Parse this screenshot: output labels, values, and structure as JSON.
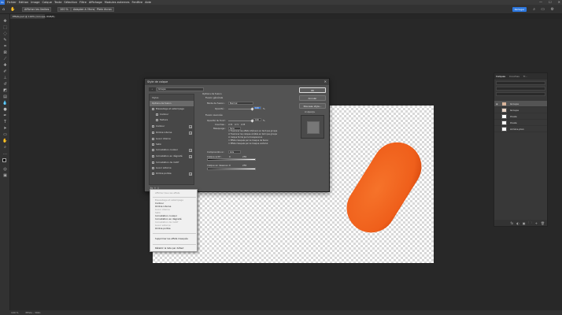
{
  "menubar": {
    "logo": "Ps",
    "items": [
      "Fichier",
      "Edition",
      "Image",
      "Calque",
      "Texte",
      "Sélection",
      "Filtre",
      "Affichage",
      "Modules externes",
      "Fenêtre",
      "Aide"
    ],
    "window_controls": [
      "—",
      "☐",
      "✕"
    ]
  },
  "optionsbar": {
    "chips": [
      "Afficher les limites",
      "100 %",
      "Adapter à l'écran",
      "Plein écran"
    ],
    "share_label": "Partager"
  },
  "document": {
    "tab_title": "Effets.psd @ 100% (Groupe, RVB/8)"
  },
  "statusbar": {
    "zoom": "100 %",
    "info": "Effets - 36Ko"
  },
  "layers_panel": {
    "tabs": [
      "Calques",
      "Couches",
      "Tr..."
    ],
    "layers": [
      {
        "name": "Groupe",
        "selected": true
      },
      {
        "name": "Groupe",
        "selected": false
      },
      {
        "name": "Ovale",
        "selected": false
      },
      {
        "name": "Ovale",
        "selected": false
      },
      {
        "name": "Arrière-plan",
        "selected": false
      }
    ],
    "footer_icons": [
      "fx",
      "◐",
      "▣",
      "🗀",
      "+",
      "🗑"
    ]
  },
  "dialog": {
    "title": "Style de calque",
    "close": "✕",
    "search_value": "Groupe",
    "styles_header": "Styles",
    "effects": [
      {
        "label": "Options de fusion",
        "selected": true,
        "checkbox": false,
        "plus": false
      },
      {
        "label": "Biseautage et estampage",
        "selected": false,
        "checkbox": true,
        "plus": false
      },
      {
        "label": "Contour",
        "selected": false,
        "checkbox": true,
        "plus": false,
        "indent": true
      },
      {
        "label": "Texture",
        "selected": false,
        "checkbox": true,
        "plus": false,
        "indent": true
      },
      {
        "label": "Contour",
        "selected": false,
        "checkbox": true,
        "plus": true
      },
      {
        "label": "Ombre interne",
        "selected": false,
        "checkbox": true,
        "plus": true
      },
      {
        "label": "Lueur interne",
        "selected": false,
        "checkbox": true,
        "plus": false
      },
      {
        "label": "Satin",
        "selected": false,
        "checkbox": true,
        "plus": false
      },
      {
        "label": "Incrustation couleur",
        "selected": false,
        "checkbox": true,
        "plus": true
      },
      {
        "label": "Incrustation en dégradé",
        "selected": false,
        "checkbox": true,
        "plus": true
      },
      {
        "label": "Incrustation de motif",
        "selected": false,
        "checkbox": true,
        "plus": false
      },
      {
        "label": "Lueur externe",
        "selected": false,
        "checkbox": true,
        "plus": false
      },
      {
        "label": "Ombre portée",
        "selected": false,
        "checkbox": true,
        "plus": true
      }
    ],
    "right": {
      "section1": "Options de fusion",
      "section1_sub": "Fusion générale",
      "mode_label": "Mode de fusion :",
      "mode_value": "Normal",
      "opacity_label": "Opacité :",
      "opacity_value": "100",
      "opacity_level": 1.0,
      "pct": "%",
      "section2": "Fusion avancée",
      "fill_label": "Opacité du fond :",
      "fill_value": "100",
      "fill_level": 1.0,
      "channels_label": "Couches :",
      "channels": [
        "R",
        "V",
        "B"
      ],
      "knockout_label": "Masquage :",
      "knockout_value": "Sans",
      "options": [
        {
          "label": "Fusionner les effets intérieurs en tant que groupe",
          "checked": false
        },
        {
          "label": "Fusionner les calques écrêtés en tant que groupe",
          "checked": true
        },
        {
          "label": "Calque formé par la transparence",
          "checked": true
        },
        {
          "label": "Effets masqués par le masque de fusion",
          "checked": false
        },
        {
          "label": "Effets masqués par le masque vectoriel",
          "checked": false
        }
      ],
      "blendif_label": "Comprendre si :",
      "blendif_value": "Gris",
      "this_layer_label": "Calque actif :",
      "this_layer_min": "0",
      "this_layer_max": "255",
      "under_layer_label": "Calque en dessous :",
      "under_layer_min": "0",
      "under_layer_max": "255"
    },
    "buttons": {
      "ok": "OK",
      "cancel": "Annuler",
      "new_style": "Nouveau style...",
      "preview": "Aperçu"
    },
    "bottom_icons": "fx ⇧ ⇩"
  },
  "context_menu": {
    "items": [
      {
        "label": "Afficher tous les effets",
        "disabled": true
      },
      {
        "label": "Biseautage et estampage",
        "disabled": true
      },
      {
        "label": "Contour",
        "disabled": false
      },
      {
        "label": "Ombre interne",
        "disabled": false
      },
      {
        "label": "Lueur interne",
        "disabled": true
      },
      {
        "label": "Satin",
        "disabled": true
      },
      {
        "label": "Incrustation couleur",
        "disabled": false
      },
      {
        "label": "Incrustation en dégradé",
        "disabled": false
      },
      {
        "label": "Incrustation de motif",
        "disabled": true
      },
      {
        "label": "Lueur externe",
        "disabled": true
      },
      {
        "label": "Ombre portée",
        "disabled": false
      },
      {
        "label": "Supprimer les effets masqués",
        "disabled": false
      },
      {
        "label": "Rétablir la liste par défaut",
        "disabled": false
      }
    ]
  },
  "colors": {
    "accent": "#2d78e0",
    "pill": "#f06421",
    "pill_dark": "#d94f12"
  }
}
